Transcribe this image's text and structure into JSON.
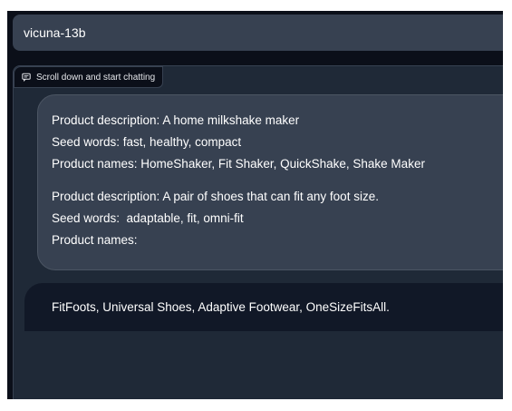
{
  "model_selector": {
    "value": "vicuna-13b"
  },
  "chat_panel": {
    "label": "Scroll down and start chatting",
    "label_icon": "chat-icon"
  },
  "conversation": {
    "user_message": {
      "lines": [
        "Product description: A home milkshake maker",
        "Seed words: fast, healthy, compact",
        "Product names: HomeShaker, Fit Shaker, QuickShake, Shake Maker",
        "",
        "Product description: A pair of shoes that can fit any foot size.",
        "Seed words:  adaptable, fit, omni-fit",
        "Product names:"
      ]
    },
    "bot_message": {
      "text": "FitFoots, Universal Shoes, Adaptive Footwear, OneSizeFitsAll."
    }
  },
  "colors": {
    "background": "#0b0f19",
    "panel": "#1f2937",
    "user_bubble": "#374151",
    "bot_bubble": "#111827",
    "text": "#ffffff"
  }
}
